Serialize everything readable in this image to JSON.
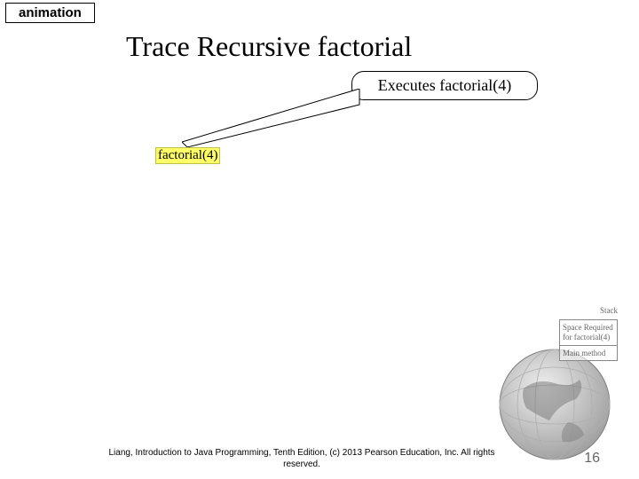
{
  "animation_label": "animation",
  "title": "Trace Recursive factorial",
  "callout": "Executes factorial(4)",
  "code_fragment": "factorial(4)",
  "stack": {
    "header": "Stack",
    "cells": [
      "Space Required for factorial(4)",
      "Main method"
    ]
  },
  "footer": "Liang, Introduction to Java Programming, Tenth Edition, (c) 2013 Pearson Education, Inc. All rights reserved.",
  "page_number": "16"
}
